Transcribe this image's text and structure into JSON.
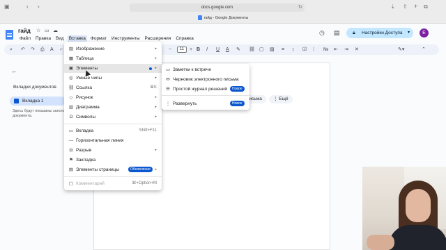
{
  "browser": {
    "url": "docs.google.com",
    "tab_title": "гайд - Google Документы"
  },
  "header": {
    "doc_title": "гайд",
    "share_label": "Настройки Доступа",
    "avatar_letter": "E"
  },
  "menubar": {
    "items": [
      "Файл",
      "Правка",
      "Вид",
      "Вставка",
      "Формат",
      "Инструменты",
      "Расширения",
      "Справка"
    ],
    "active": "Вставка"
  },
  "toolbar": {
    "font_size": "11"
  },
  "sidebar": {
    "heading": "Вкладки документов",
    "tab_label": "Вкладка 1",
    "note": "Здесь будут показаны заголовки документа."
  },
  "insert_menu": {
    "items": [
      {
        "label": "Изображение",
        "icon": "image-icon",
        "submenu": true
      },
      {
        "label": "Таблица",
        "icon": "table-icon",
        "submenu": true
      },
      {
        "label": "Элементы",
        "icon": "building-blocks-icon",
        "submenu": true,
        "highlighted": true
      },
      {
        "label": "Умные чипы",
        "icon": "smart-chip-icon",
        "submenu": true
      },
      {
        "label": "Ссылка",
        "icon": "link-icon",
        "shortcut": "⌘K"
      },
      {
        "label": "Рисунок",
        "icon": "drawing-icon",
        "submenu": true
      },
      {
        "label": "Диаграмма",
        "icon": "chart-icon",
        "submenu": true
      },
      {
        "label": "Символы",
        "icon": "omega-icon",
        "submenu": true
      },
      {
        "label": "Вкладка",
        "icon": "tab-icon",
        "shortcut": "Shift+F11"
      },
      {
        "label": "Горизонтальная линия",
        "icon": "horizontal-line-icon"
      },
      {
        "label": "Разрыв",
        "icon": "break-icon",
        "submenu": true
      },
      {
        "label": "Закладка",
        "icon": "bookmark-icon"
      },
      {
        "label": "Элементы страницы",
        "icon": "page-elements-icon",
        "submenu": true,
        "badge": "Обновление"
      },
      {
        "label": "Комментарий",
        "icon": "comment-icon",
        "shortcut": "⌘+Option+M",
        "disabled": true
      }
    ]
  },
  "elements_submenu": {
    "items": [
      {
        "label": "Заметки к встрече",
        "icon": "meeting-notes-icon"
      },
      {
        "label": "Черновик электронного письма",
        "icon": "email-draft-icon"
      },
      {
        "label": "Простой журнал решений",
        "icon": "decision-log-icon",
        "badge": "Новое"
      },
      {
        "label": "Развернуть",
        "icon": "expand-icon",
        "badge": "Новое"
      }
    ]
  },
  "page": {
    "chip_email": "письма",
    "chip_more": "Ещё"
  },
  "colors": {
    "accent": "#0b57d0",
    "share_bg": "#c2e7ff",
    "toolbar_bg": "#edf2fa",
    "avatar": "#7b1fa2"
  }
}
